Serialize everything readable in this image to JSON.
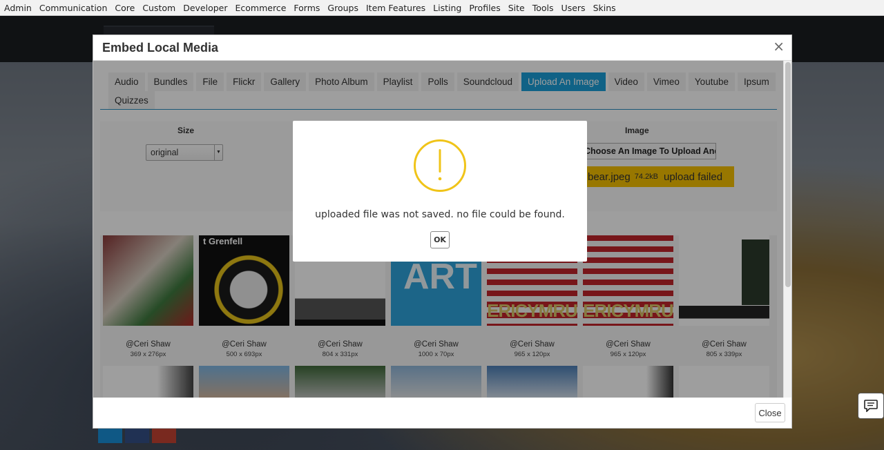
{
  "topbar": {
    "items": [
      "Admin",
      "Communication",
      "Core",
      "Custom",
      "Developer",
      "Ecommerce",
      "Forms",
      "Groups",
      "Item Features",
      "Listing",
      "Profiles",
      "Site",
      "Tools",
      "Users",
      "Skins"
    ]
  },
  "modal": {
    "title": "Embed Local Media",
    "close_x": "×",
    "close_button": "Close",
    "tabs": [
      {
        "label": "Audio",
        "active": false
      },
      {
        "label": "Bundles",
        "active": false
      },
      {
        "label": "File",
        "active": false
      },
      {
        "label": "Flickr",
        "active": false
      },
      {
        "label": "Gallery",
        "active": false
      },
      {
        "label": "Photo Album",
        "active": false
      },
      {
        "label": "Playlist",
        "active": false
      },
      {
        "label": "Polls",
        "active": false
      },
      {
        "label": "Soundcloud",
        "active": false
      },
      {
        "label": "Upload An Image",
        "active": true
      },
      {
        "label": "Video",
        "active": false
      },
      {
        "label": "Vimeo",
        "active": false
      },
      {
        "label": "Youtube",
        "active": false
      },
      {
        "label": "Ipsum",
        "active": false
      },
      {
        "label": "Quizzes",
        "active": false
      }
    ],
    "form": {
      "size_label": "Size",
      "size_value": "original",
      "image_label": "Image",
      "choose_button": "Choose An Image To Upload And Insert",
      "upload_filename": "bear.jpeg",
      "upload_size": "74.2kB",
      "upload_status": "upload failed"
    },
    "gallery": [
      {
        "author": "@Ceri Shaw",
        "dims": "369 x 276px"
      },
      {
        "author": "@Ceri Shaw",
        "dims": "500 x 693px",
        "caption": "t Grenfell"
      },
      {
        "author": "@Ceri Shaw",
        "dims": "804 x 331px"
      },
      {
        "author": "@Ceri Shaw",
        "dims": "1000 x 70px",
        "caption": "ART"
      },
      {
        "author": "@Ceri Shaw",
        "dims": "965 x 120px",
        "caption": "ERICYMRU"
      },
      {
        "author": "@Ceri Shaw",
        "dims": "965 x 120px",
        "caption": "ERICYMRU"
      },
      {
        "author": "@Ceri Shaw",
        "dims": "805 x 339px"
      }
    ]
  },
  "alert": {
    "message": "uploaded file was not saved. no file could be found.",
    "ok": "OK"
  },
  "colors": {
    "accent": "#1a9ed8",
    "warning": "#f5c000",
    "alert_icon": "#f0c419"
  }
}
